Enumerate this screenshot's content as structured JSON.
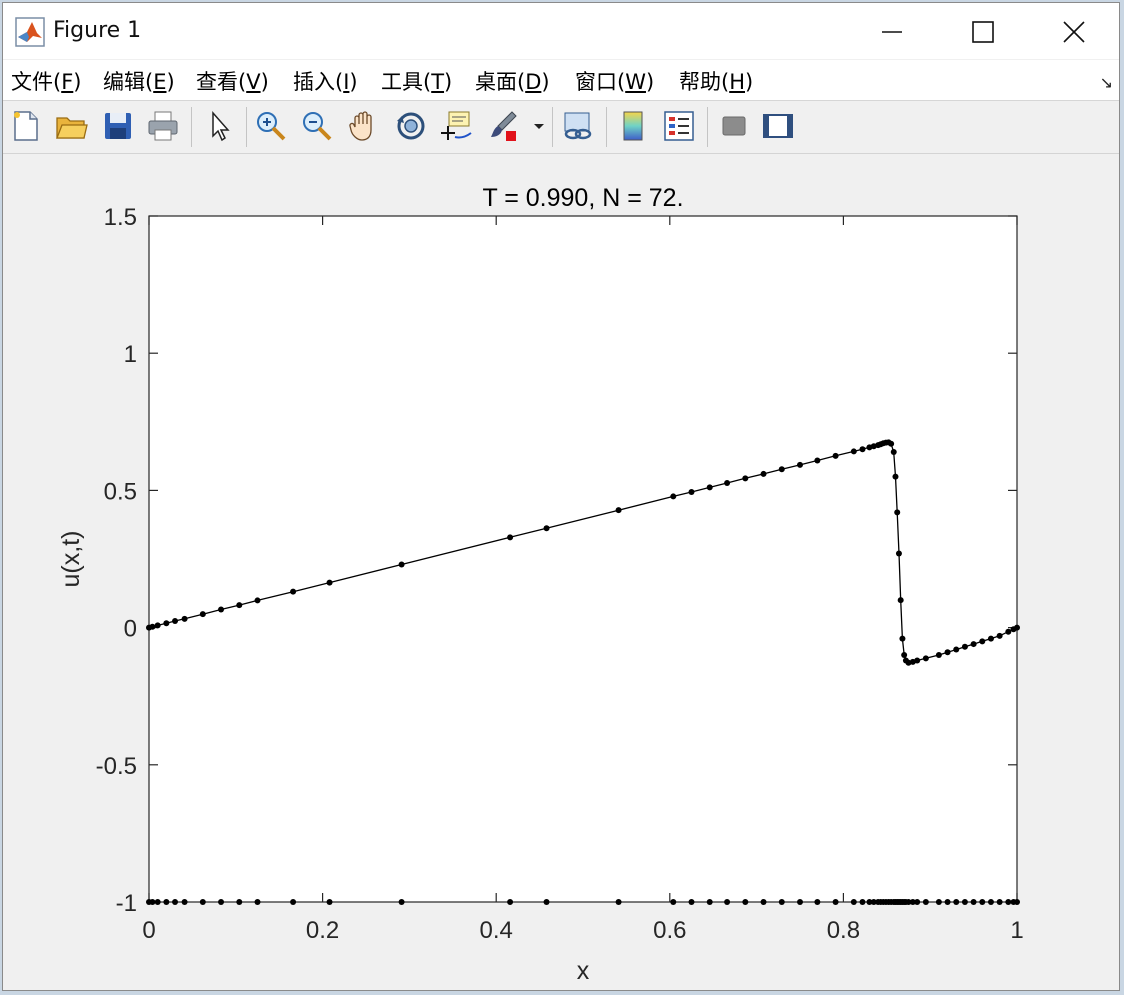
{
  "window": {
    "title": "Figure 1",
    "menu": [
      {
        "label": "文件(",
        "key": "F",
        "tail": ")"
      },
      {
        "label": "编辑(",
        "key": "E",
        "tail": ")"
      },
      {
        "label": "查看(",
        "key": "V",
        "tail": ")"
      },
      {
        "label": "插入(",
        "key": "I",
        "tail": ")"
      },
      {
        "label": "工具(",
        "key": "T",
        "tail": ")"
      },
      {
        "label": "桌面(",
        "key": "D",
        "tail": ")"
      },
      {
        "label": "窗口(",
        "key": "W",
        "tail": ")"
      },
      {
        "label": "帮助(",
        "key": "H",
        "tail": ")"
      }
    ],
    "toolbar_icons": [
      "new-figure-icon",
      "open-file-icon",
      "save-icon",
      "print-icon",
      "edit-plot-arrow-icon",
      "zoom-in-icon",
      "zoom-out-icon",
      "pan-hand-icon",
      "rotate-3d-icon",
      "data-cursor-icon",
      "brush-icon",
      "brush-dropdown-icon",
      "link-plot-icon",
      "colorbar-icon",
      "legend-icon",
      "hide-plot-tools-icon",
      "show-plot-tools-icon"
    ]
  },
  "chart_data": {
    "type": "line",
    "title": "T = 0.990,    N =  72.",
    "xlabel": "x",
    "ylabel": "u(x,t)",
    "xlim": [
      0,
      1
    ],
    "ylim": [
      -1,
      1.5
    ],
    "xticks": [
      "0",
      "0.2",
      "0.4",
      "0.6",
      "0.8",
      "1"
    ],
    "yticks": [
      "-1",
      "-0.5",
      "0",
      "0.5",
      "1",
      "1.5"
    ],
    "grid": false,
    "series": [
      {
        "marker": "dot",
        "color": "#000000",
        "x": [
          0,
          0.004,
          0.01,
          0.02,
          0.03,
          0.041,
          0.062,
          0.083,
          0.104,
          0.125,
          0.166,
          0.208,
          0.291,
          0.416,
          0.458,
          0.541,
          0.604,
          0.625,
          0.646,
          0.666,
          0.687,
          0.708,
          0.729,
          0.75,
          0.77,
          0.791,
          0.812,
          0.822,
          0.83,
          0.835,
          0.84,
          0.843,
          0.846,
          0.849,
          0.852,
          0.855,
          0.858,
          0.86,
          0.862,
          0.864,
          0.866,
          0.868,
          0.87,
          0.872,
          0.875,
          0.88,
          0.885,
          0.895,
          0.91,
          0.92,
          0.93,
          0.94,
          0.95,
          0.96,
          0.97,
          0.98,
          0.99,
          0.996,
          1.0
        ],
        "y": [
          0,
          0.003,
          0.008,
          0.016,
          0.024,
          0.032,
          0.049,
          0.066,
          0.082,
          0.099,
          0.131,
          0.164,
          0.23,
          0.329,
          0.362,
          0.428,
          0.478,
          0.494,
          0.511,
          0.527,
          0.544,
          0.56,
          0.577,
          0.593,
          0.609,
          0.626,
          0.642,
          0.65,
          0.657,
          0.661,
          0.665,
          0.668,
          0.672,
          0.674,
          0.675,
          0.67,
          0.64,
          0.55,
          0.42,
          0.27,
          0.1,
          -0.04,
          -0.1,
          -0.12,
          -0.128,
          -0.125,
          -0.12,
          -0.112,
          -0.1,
          -0.09,
          -0.08,
          -0.07,
          -0.06,
          -0.05,
          -0.04,
          -0.03,
          -0.015,
          -0.006,
          0
        ]
      }
    ],
    "baseline_markers": {
      "y": -1,
      "x": [
        0,
        0.004,
        0.01,
        0.02,
        0.03,
        0.041,
        0.062,
        0.083,
        0.104,
        0.125,
        0.166,
        0.208,
        0.291,
        0.416,
        0.458,
        0.541,
        0.604,
        0.625,
        0.646,
        0.666,
        0.687,
        0.708,
        0.729,
        0.75,
        0.77,
        0.791,
        0.812,
        0.822,
        0.83,
        0.835,
        0.84,
        0.843,
        0.846,
        0.849,
        0.852,
        0.855,
        0.858,
        0.86,
        0.862,
        0.864,
        0.866,
        0.868,
        0.87,
        0.872,
        0.875,
        0.88,
        0.885,
        0.895,
        0.91,
        0.92,
        0.93,
        0.94,
        0.95,
        0.96,
        0.97,
        0.98,
        0.99,
        0.996,
        1.0
      ]
    }
  }
}
